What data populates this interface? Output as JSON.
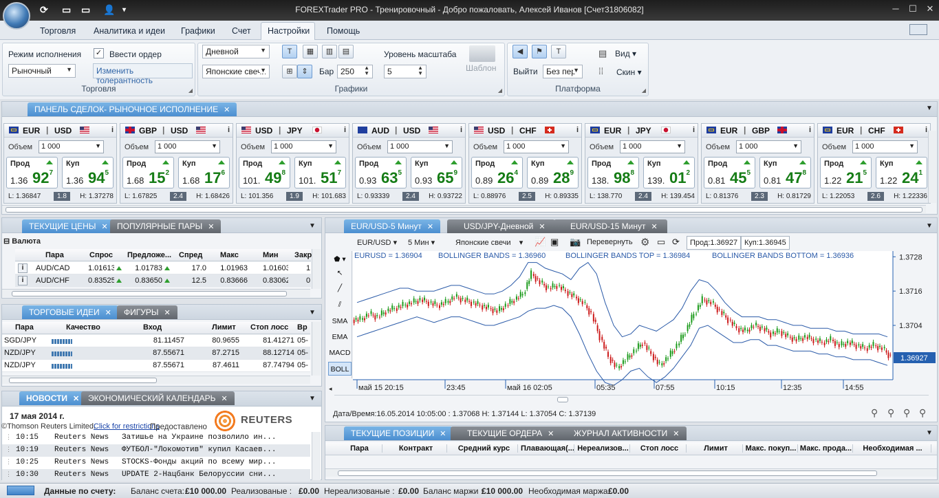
{
  "window": {
    "title": "FOREXTrader PRO - Тренировочный - Добро пожаловать,  Алексей Иванов [Счет31806082]"
  },
  "menu": {
    "tabs": [
      "Торговля",
      "Аналитика и идеи",
      "Графики",
      "Счет",
      "Настройки",
      "Помощь"
    ],
    "active": "Настройки"
  },
  "ribbon": {
    "trading": {
      "exec_mode_label": "Режим исполнения",
      "exec_mode_value": "Рыночный",
      "enter_order_label": "Ввести ордер",
      "change_tolerance": "Изменить толерантность",
      "group_label": "Торговля"
    },
    "charts": {
      "timeframe": "Дневной",
      "chart_type": "Японские свечи",
      "bars_label": "Бар",
      "bars_value": "250",
      "scale_label": "Уровень масштаба",
      "scale_value": "5",
      "group_label": "Графики"
    },
    "template_label": "Шаблон",
    "platform": {
      "exit_label": "Выйти",
      "exit_value": "Без пер",
      "view_label": "Вид",
      "skin_label": "Скин",
      "group_label": "Платформа"
    }
  },
  "deals_panel": {
    "tab": "ПАНЕЛЬ СДЕЛОК- РЫНОЧНОЕ ИСПОЛНЕНИЕ",
    "volume_label": "Объем",
    "sell_label": "Прод",
    "buy_label": "Куп",
    "cards": [
      {
        "base": "EUR",
        "quote": "USD",
        "volume": "1 000",
        "sell_small": "1.36",
        "sell_big": "92",
        "sell_sup": "7",
        "buy_small": "1.36",
        "buy_big": "94",
        "buy_sup": "5",
        "low": "L: 1.36847",
        "spread": "1.8",
        "high": "H: 1.37278",
        "bflag": "eu",
        "qflag": "us"
      },
      {
        "base": "GBP",
        "quote": "USD",
        "volume": "1 000",
        "sell_small": "1.68",
        "sell_big": "15",
        "sell_sup": "2",
        "buy_small": "1.68",
        "buy_big": "17",
        "buy_sup": "6",
        "low": "L: 1.67825",
        "spread": "2.4",
        "high": "H: 1.68426",
        "bflag": "gb",
        "qflag": "us"
      },
      {
        "base": "USD",
        "quote": "JPY",
        "volume": "1 000",
        "sell_small": "101.",
        "sell_big": "49",
        "sell_sup": "8",
        "buy_small": "101.",
        "buy_big": "51",
        "buy_sup": "7",
        "low": "L: 101.356",
        "spread": "1.9",
        "high": "H: 101.683",
        "bflag": "us",
        "qflag": "jp"
      },
      {
        "base": "AUD",
        "quote": "USD",
        "volume": "1 000",
        "sell_small": "0.93",
        "sell_big": "63",
        "sell_sup": "5",
        "buy_small": "0.93",
        "buy_big": "65",
        "buy_sup": "9",
        "low": "L: 0.93339",
        "spread": "2.4",
        "high": "H: 0.93722",
        "bflag": "au",
        "qflag": "us"
      },
      {
        "base": "USD",
        "quote": "CHF",
        "volume": "1 000",
        "sell_small": "0.89",
        "sell_big": "26",
        "sell_sup": "4",
        "buy_small": "0.89",
        "buy_big": "28",
        "buy_sup": "9",
        "low": "L: 0.88976",
        "spread": "2.5",
        "high": "H: 0.89335",
        "bflag": "us",
        "qflag": "ch"
      },
      {
        "base": "EUR",
        "quote": "JPY",
        "volume": "1 000",
        "sell_small": "138.",
        "sell_big": "98",
        "sell_sup": "8",
        "buy_small": "139.",
        "buy_big": "01",
        "buy_sup": "2",
        "low": "L: 138.770",
        "spread": "2.4",
        "high": "H: 139.454",
        "bflag": "eu",
        "qflag": "jp"
      },
      {
        "base": "EUR",
        "quote": "GBP",
        "volume": "1 000",
        "sell_small": "0.81",
        "sell_big": "45",
        "sell_sup": "5",
        "buy_small": "0.81",
        "buy_big": "47",
        "buy_sup": "8",
        "low": "L: 0.81376",
        "spread": "2.3",
        "high": "H: 0.81729",
        "bflag": "eu",
        "qflag": "gb"
      },
      {
        "base": "EUR",
        "quote": "CHF",
        "volume": "1 000",
        "sell_small": "1.22",
        "sell_big": "21",
        "sell_sup": "5",
        "buy_small": "1.22",
        "buy_big": "24",
        "buy_sup": "1",
        "low": "L: 1.22053",
        "spread": "2.6",
        "high": "H: 1.22336",
        "bflag": "eu",
        "qflag": "ch"
      }
    ]
  },
  "prices": {
    "tabs": [
      "ТЕКУЩИЕ ЦЕНЫ",
      "ПОПУЛЯРНЫЕ ПАРЫ"
    ],
    "group": "Валюта",
    "columns": [
      "Пара",
      "Спрос",
      "Предложе...",
      "Спред",
      "Макс",
      "Мин",
      "Закр"
    ],
    "rows": [
      [
        "AUD/CAD",
        "1.01613",
        "1.01783",
        "17.0",
        "1.01963",
        "1.01603",
        "1"
      ],
      [
        "AUD/CHF",
        "0.83525",
        "0.83650",
        "12.5",
        "0.83666",
        "0.83062",
        "0"
      ]
    ]
  },
  "ideas": {
    "tabs": [
      "ТОРГОВЫЕ ИДЕИ",
      "ФИГУРЫ"
    ],
    "columns": [
      "Пара",
      "Качество",
      "Вход",
      "Лимит",
      "Стоп лосс",
      "Вр"
    ],
    "rows": [
      [
        "SGD/JPY",
        "81.11457",
        "80.9655",
        "81.41271",
        "05-"
      ],
      [
        "NZD/JPY",
        "87.55671",
        "87.2715",
        "88.12714",
        "05-"
      ],
      [
        "NZD/JPY",
        "87.55671",
        "87.4611",
        "87.74794",
        "05-"
      ]
    ]
  },
  "news": {
    "tabs": [
      "НОВОСТИ",
      "ЭКОНОМИЧЕСКИЙ КАЛЕНДАРЬ"
    ],
    "date": "17 мая 2014 г.",
    "copyright": "©Thomson Reuters Limited.",
    "restrictions": "Click for restrictions",
    "provided": "Предоставлено",
    "brand": "REUTERS",
    "items": [
      {
        "time": "10:15",
        "source": "Reuters News",
        "headline": "Затишье на Украине позволило ин..."
      },
      {
        "time": "10:19",
        "source": "Reuters News",
        "headline": "ФУТБОЛ-\"Локомотив\" купил Касаев..."
      },
      {
        "time": "10:25",
        "source": "Reuters News",
        "headline": "STOCKS-Фонды акций по всему мир..."
      },
      {
        "time": "10:30",
        "source": "Reuters News",
        "headline": "UPDATE 2-Нацбанк Белоруссии сни..."
      }
    ]
  },
  "chart_panel": {
    "tabs": [
      "EUR/USD-5 Минут",
      "USD/JPY-Дневной",
      "EUR/USD-15 Минут"
    ],
    "toolbar": {
      "symbol": "EUR/USD",
      "timeframe": "5 Мин",
      "type": "Японские свечи",
      "flip": "Перевернуть",
      "sell": "Прод:1.36927",
      "buy": "Куп:1.36945"
    },
    "tools": [
      "SMA",
      "EMA",
      "MACD",
      "BOLL"
    ],
    "legend": [
      "EURUSD = 1.36904",
      "BOLLINGER BANDS = 1.36960",
      "BOLLINGER BANDS TOP = 1.36984",
      "BOLLINGER BANDS BOTTOM = 1.36936"
    ],
    "datetime": "Дата/Время:16.05.2014 10:05:00 : 1.37068 H: 1.37144 L: 1.37054 C: 1.37139",
    "colors": {
      "up": "#1a9a1a",
      "down": "#cc1a1a",
      "band": "#2a5aa8",
      "last": "#2560b0"
    }
  },
  "chart_data": {
    "type": "line",
    "title": "",
    "series_name": "EURUSD",
    "x_ticks": [
      "май 15 20:15",
      "23:45",
      "май 16 02:05",
      "05:35",
      "07:55",
      "10:15",
      "12:35",
      "14:55"
    ],
    "y_ticks": [
      1.3728,
      1.3716,
      1.3704
    ],
    "ylim": [
      1.3685,
      1.373
    ],
    "last_price": 1.36927,
    "close": [
      1.3706,
      1.3708,
      1.3707,
      1.3709,
      1.371,
      1.3711,
      1.3712,
      1.3713,
      1.3712,
      1.3711,
      1.3712,
      1.3714,
      1.3713,
      1.3712,
      1.3711,
      1.371,
      1.3709,
      1.3711,
      1.3713,
      1.3715,
      1.3722,
      1.3719,
      1.3717,
      1.3718,
      1.3716,
      1.3714,
      1.3712,
      1.3708,
      1.37,
      1.3693,
      1.3689,
      1.3692,
      1.3695,
      1.3698,
      1.3694,
      1.369,
      1.3693,
      1.3697,
      1.3702,
      1.3708,
      1.3713,
      1.3712,
      1.3709,
      1.3706,
      1.3703,
      1.3702,
      1.3704,
      1.3703,
      1.3701,
      1.3702,
      1.37,
      1.3699,
      1.37,
      1.3699,
      1.3698,
      1.3699,
      1.3697,
      1.3698,
      1.3697,
      1.3696,
      1.3697,
      1.3696,
      1.3693
    ],
    "bb_top": [
      1.3712,
      1.3713,
      1.3714,
      1.3715,
      1.3716,
      1.3717,
      1.3717,
      1.3716,
      1.3716,
      1.3716,
      1.3717,
      1.3718,
      1.3718,
      1.3717,
      1.3716,
      1.3715,
      1.3715,
      1.3716,
      1.3718,
      1.3721,
      1.3726,
      1.3726,
      1.3724,
      1.3723,
      1.3722,
      1.372,
      1.3724,
      1.3726,
      1.3722,
      1.3712,
      1.3704,
      1.37,
      1.3701,
      1.3704,
      1.3703,
      1.3702,
      1.3704,
      1.3706,
      1.371,
      1.3716,
      1.372,
      1.3719,
      1.3716,
      1.3712,
      1.3709,
      1.3707,
      1.3707,
      1.3707,
      1.3706,
      1.3706,
      1.3705,
      1.3704,
      1.3704,
      1.3703,
      1.3703,
      1.3703,
      1.3702,
      1.3702,
      1.3701,
      1.3701,
      1.3701,
      1.3701,
      1.37
    ],
    "bb_bottom": [
      1.37,
      1.3701,
      1.3702,
      1.3703,
      1.3704,
      1.3705,
      1.3706,
      1.3707,
      1.3706,
      1.3705,
      1.3706,
      1.3707,
      1.3707,
      1.3706,
      1.3705,
      1.3704,
      1.3704,
      1.3705,
      1.3706,
      1.3707,
      1.3709,
      1.371,
      1.371,
      1.3711,
      1.371,
      1.3707,
      1.3701,
      1.3694,
      1.3688,
      1.3684,
      1.3683,
      1.3685,
      1.3688,
      1.3689,
      1.3686,
      1.3684,
      1.3686,
      1.3689,
      1.3693,
      1.3697,
      1.3703,
      1.3704,
      1.3702,
      1.37,
      1.3698,
      1.3698,
      1.3699,
      1.3699,
      1.3697,
      1.3697,
      1.3696,
      1.3695,
      1.3695,
      1.3695,
      1.3694,
      1.3694,
      1.3693,
      1.3693,
      1.3692,
      1.3692,
      1.3692,
      1.3691,
      1.369
    ]
  },
  "positions": {
    "tabs": [
      "ТЕКУЩИЕ ПОЗИЦИИ",
      "ТЕКУЩИЕ ОРДЕРА",
      "ЖУРНАЛ АКТИВНОСТИ"
    ],
    "columns": [
      "Пара",
      "Контракт",
      "Средний курс",
      "Плавающая(...",
      "Нереализов...",
      "Стоп лосс",
      "Лимит",
      "Макс. покуп...",
      "Макс. прода...",
      "Необходимая ..."
    ]
  },
  "statusbar": {
    "title": "Данные по счету:",
    "balance_label": "Баланс счета:",
    "balance": "£10 000.00",
    "realized_label": "Реализованые :",
    "realized": "£0.00",
    "unrealized_label": "Нереализованые :",
    "unrealized": "£0.00",
    "margin_label": "Баланс маржи :",
    "margin": "£10 000.00",
    "required_label": "Необходимая маржа:",
    "required": "£0.00"
  }
}
